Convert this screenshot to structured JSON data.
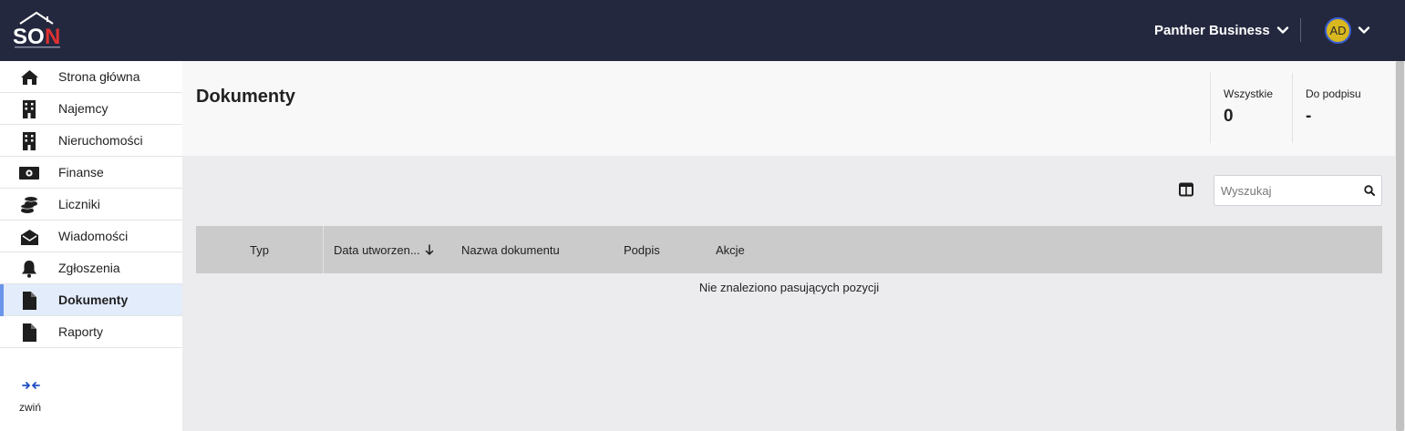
{
  "header": {
    "logo_text": "SON",
    "company_name": "Panther Business",
    "avatar_initials": "AD"
  },
  "sidebar": {
    "items": [
      {
        "label": "Strona główna",
        "icon": "home-icon"
      },
      {
        "label": "Najemcy",
        "icon": "building-icon"
      },
      {
        "label": "Nieruchomości",
        "icon": "building-icon"
      },
      {
        "label": "Finanse",
        "icon": "money-icon"
      },
      {
        "label": "Liczniki",
        "icon": "coins-icon"
      },
      {
        "label": "Wiadomości",
        "icon": "envelope-open-icon"
      },
      {
        "label": "Zgłoszenia",
        "icon": "bell-icon"
      },
      {
        "label": "Dokumenty",
        "icon": "file-icon",
        "active": true
      },
      {
        "label": "Raporty",
        "icon": "file-icon"
      }
    ],
    "collapse_label": "zwiń"
  },
  "main": {
    "title": "Dokumenty",
    "stats": [
      {
        "label": "Wszystkie",
        "value": "0"
      },
      {
        "label": "Do podpisu",
        "value": "-"
      }
    ],
    "search_placeholder": "Wyszukaj",
    "table": {
      "columns": [
        "Typ",
        "Data utworzen...",
        "Nazwa dokumentu",
        "Podpis",
        "Akcje"
      ],
      "empty_message": "Nie znaleziono pasujących pozycji"
    }
  },
  "colors": {
    "topbar": "#24283f",
    "active_accent": "#6b95ea",
    "active_bg": "#e3ecfb",
    "logo_red": "#e03131"
  }
}
